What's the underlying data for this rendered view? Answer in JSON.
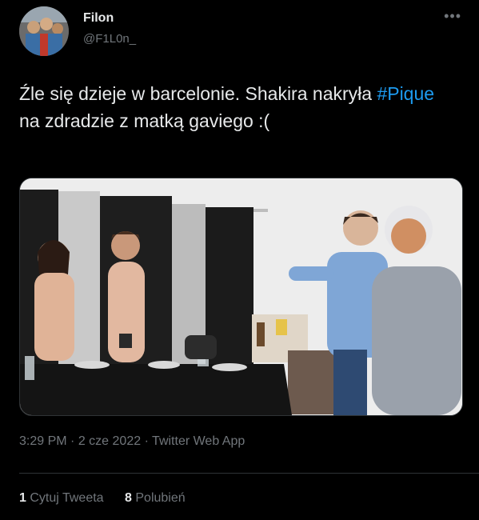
{
  "author": {
    "name": "Filon",
    "handle": "@F1L0n_"
  },
  "tweet": {
    "text_before": "Źle się dzieje w barcelonie. Shakira nakryła ",
    "hashtag": "#Pique",
    "text_after": " na zdradzie z matką gaviego :("
  },
  "meta": {
    "time": "3:29 PM",
    "date": "2 cze 2022",
    "source": "Twitter Web App",
    "separator": "·"
  },
  "stats": {
    "quote_count": "1",
    "quote_label": "Cytuj Tweeta",
    "like_count": "8",
    "like_label": "Polubień"
  },
  "icons": {
    "more": "more-icon"
  },
  "colors": {
    "background": "#000000",
    "text": "#e7e9ea",
    "secondary": "#71767b",
    "accent": "#1d9bf0",
    "divider": "#2f3336"
  }
}
